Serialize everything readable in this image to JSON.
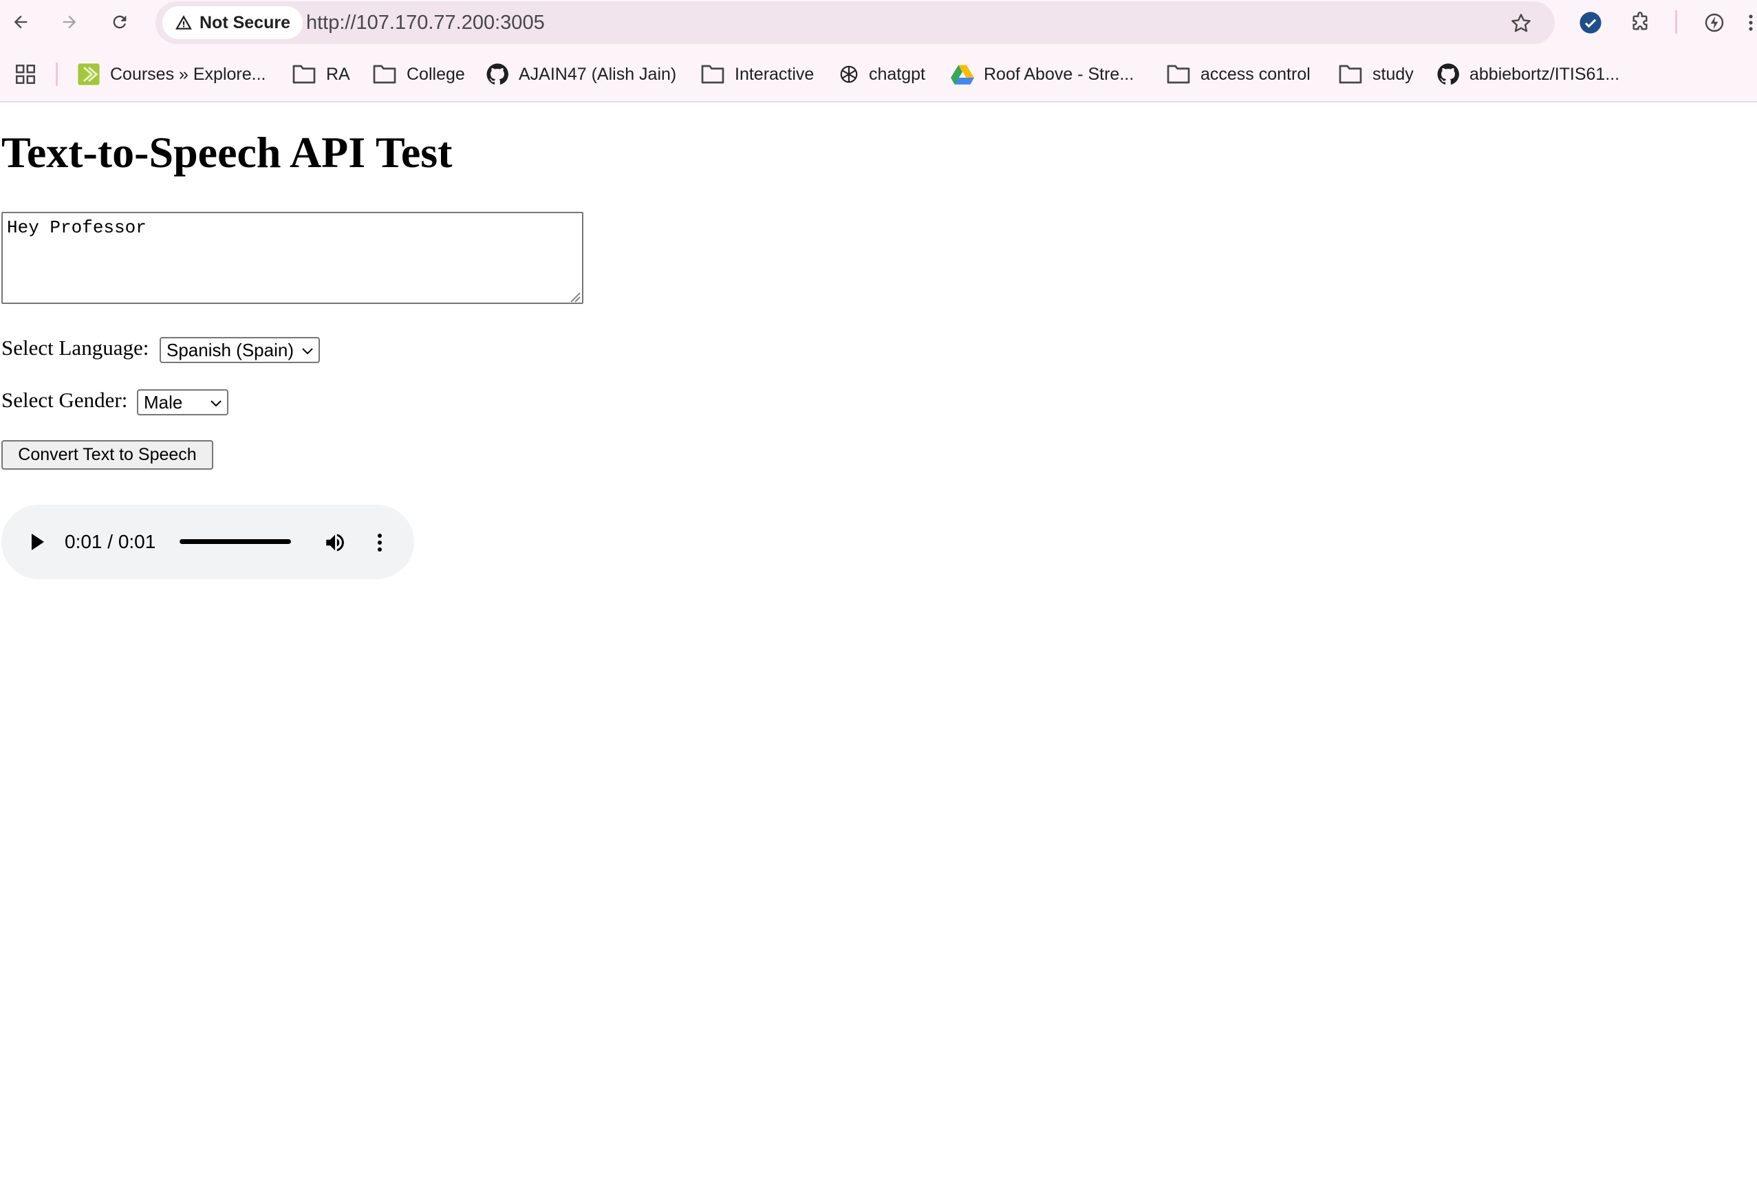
{
  "browser": {
    "security_label": "Not Secure",
    "url": "http://107.170.77.200:3005",
    "colors": {
      "toolbar_bg": "#fcf4f8",
      "omnibox_bg": "#f1e4ec",
      "profile_badge": "#1f4e8c"
    },
    "icons": [
      "back-arrow-icon",
      "forward-arrow-icon",
      "reload-icon",
      "warning-icon",
      "star-icon",
      "profile-check-icon",
      "extensions-puzzle-icon",
      "performance-icon",
      "menu-icon"
    ]
  },
  "bookmarks": [
    {
      "label": "Courses » Explore...",
      "icon": "courses-favicon-icon"
    },
    {
      "label": "RA",
      "icon": "folder-icon"
    },
    {
      "label": "College",
      "icon": "folder-icon"
    },
    {
      "label": "AJAIN47 (Alish Jain)",
      "icon": "github-icon"
    },
    {
      "label": "Interactive",
      "icon": "folder-icon"
    },
    {
      "label": "chatgpt",
      "icon": "openai-icon"
    },
    {
      "label": "Roof Above - Stre...",
      "icon": "google-drive-icon"
    },
    {
      "label": "access control",
      "icon": "folder-icon"
    },
    {
      "label": "study",
      "icon": "folder-icon"
    },
    {
      "label": "abbiebortz/ITIS61...",
      "icon": "github-icon"
    }
  ],
  "page": {
    "title": "Text-to-Speech API Test",
    "text_input": "Hey Professor",
    "language_label": "Select Language:",
    "language_value": "Spanish (Spain)",
    "gender_label": "Select Gender:",
    "gender_value": "Male",
    "convert_button": "Convert Text to Speech"
  },
  "audio": {
    "time": "0:01 / 0:01",
    "progress": 1.0
  }
}
